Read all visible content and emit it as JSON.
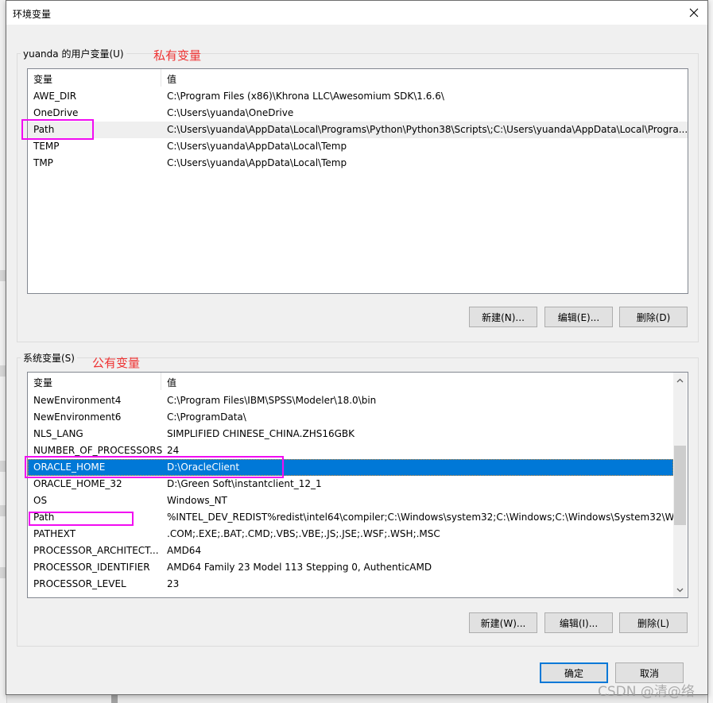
{
  "dialog": {
    "title": "环境变量",
    "close_icon": "close-icon"
  },
  "user_vars": {
    "group_label": "yuanda 的用户变量(U)",
    "annotation": "私有变量",
    "columns": [
      "变量",
      "值"
    ],
    "rows": [
      {
        "name": "AWE_DIR",
        "value": "C:\\Program Files (x86)\\Khrona LLC\\Awesomium SDK\\1.6.6\\"
      },
      {
        "name": "OneDrive",
        "value": "C:\\Users\\yuanda\\OneDrive"
      },
      {
        "name": "Path",
        "value": "C:\\Users\\yuanda\\AppData\\Local\\Programs\\Python\\Python38\\Scripts\\;C:\\Users\\yuanda\\AppData\\Local\\Progra..."
      },
      {
        "name": "TEMP",
        "value": "C:\\Users\\yuanda\\AppData\\Local\\Temp"
      },
      {
        "name": "TMP",
        "value": "C:\\Users\\yuanda\\AppData\\Local\\Temp"
      }
    ],
    "hovered_row": "Path",
    "buttons": {
      "new": "新建(N)...",
      "edit": "编辑(E)...",
      "delete": "删除(D)"
    }
  },
  "system_vars": {
    "group_label": "系统变量(S)",
    "annotation": "公有变量",
    "columns": [
      "变量",
      "值"
    ],
    "rows": [
      {
        "name": "NewEnvironment4",
        "value": "C:\\Program Files\\IBM\\SPSS\\Modeler\\18.0\\bin"
      },
      {
        "name": "NewEnvironment6",
        "value": "C:\\ProgramData\\"
      },
      {
        "name": "NLS_LANG",
        "value": "SIMPLIFIED CHINESE_CHINA.ZHS16GBK"
      },
      {
        "name": "NUMBER_OF_PROCESSORS",
        "value": "24"
      },
      {
        "name": "ORACLE_HOME",
        "value": "D:\\OracleClient"
      },
      {
        "name": "ORACLE_HOME_32",
        "value": "D:\\Green Soft\\instantclient_12_1"
      },
      {
        "name": "OS",
        "value": "Windows_NT"
      },
      {
        "name": "Path",
        "value": "%INTEL_DEV_REDIST%redist\\intel64\\compiler;C:\\Windows\\system32;C:\\Windows;C:\\Windows\\System32\\W..."
      },
      {
        "name": "PATHEXT",
        "value": ".COM;.EXE;.BAT;.CMD;.VBS;.VBE;.JS;.JSE;.WSF;.WSH;.MSC"
      },
      {
        "name": "PROCESSOR_ARCHITECT...",
        "value": "AMD64"
      },
      {
        "name": "PROCESSOR_IDENTIFIER",
        "value": "AMD64 Family 23 Model 113 Stepping 0, AuthenticAMD"
      },
      {
        "name": "PROCESSOR_LEVEL",
        "value": "23"
      }
    ],
    "selected_row": "ORACLE_HOME",
    "scroll_position_fraction": 0.4,
    "buttons": {
      "new": "新建(W)...",
      "edit": "编辑(I)...",
      "delete": "删除(L)"
    }
  },
  "footer": {
    "ok": "确定",
    "cancel": "取消"
  },
  "watermark": "CSDN @清@络",
  "colors": {
    "selection": "#0078d7",
    "annotation_red": "#ee3333",
    "highlight_magenta": "#f20cf2"
  }
}
